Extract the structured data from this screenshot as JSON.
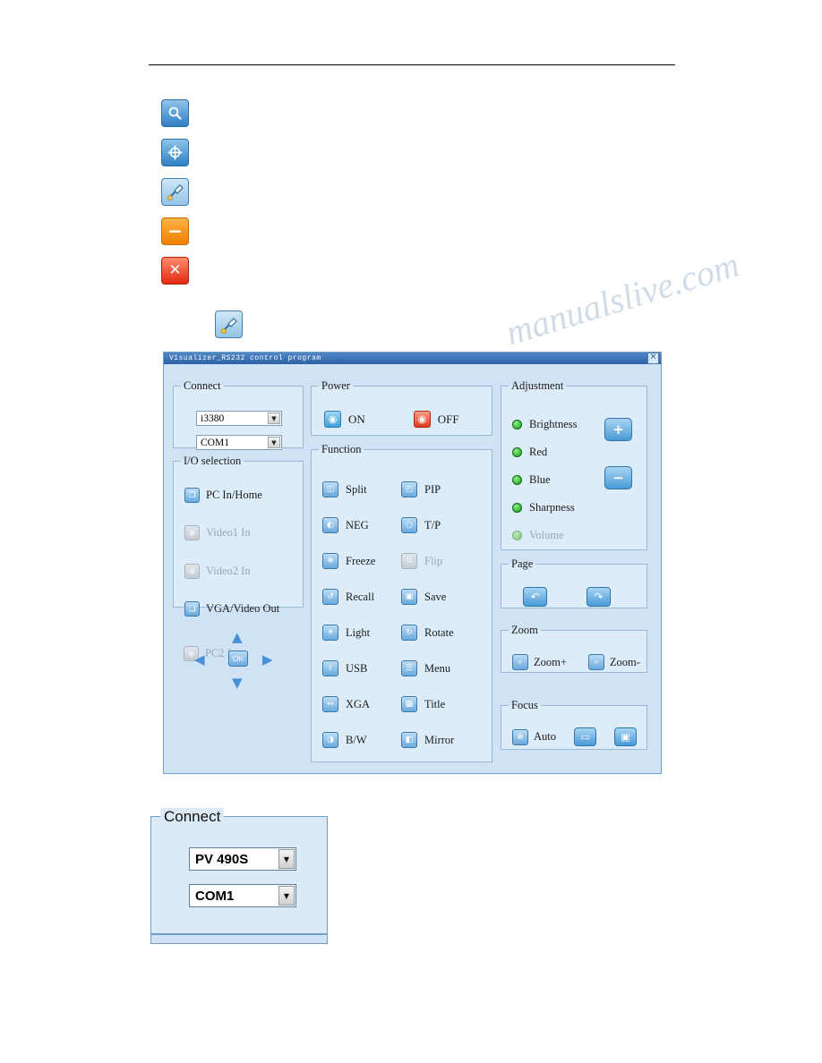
{
  "icon_column": [
    {
      "name": "search-icon",
      "glyph": "⌕"
    },
    {
      "name": "focus-target-icon",
      "glyph": "⊕"
    },
    {
      "name": "lamp-icon",
      "glyph": ""
    },
    {
      "name": "minimize-icon",
      "glyph": "−"
    },
    {
      "name": "close-icon",
      "glyph": "✕"
    }
  ],
  "window": {
    "title": "Visualizer_RS232 control program",
    "close_label": "×"
  },
  "connect": {
    "legend": "Connect",
    "model": "i3380",
    "port": "COM1",
    "arrow": "▼"
  },
  "io_selection": {
    "legend": "I/O selection",
    "items": [
      {
        "label": "PC In/Home",
        "glyph": "❐",
        "enabled": true
      },
      {
        "label": "Video1 In",
        "glyph": "◉",
        "enabled": false
      },
      {
        "label": "Video2 In",
        "glyph": "◉",
        "enabled": false
      },
      {
        "label": "VGA/Video Out",
        "glyph": "❑",
        "enabled": true
      },
      {
        "label": "PC2 In",
        "glyph": "◉",
        "enabled": false
      }
    ]
  },
  "navpad": {
    "up": "▲",
    "down": "▼",
    "left": "◀",
    "right": "▶",
    "ok": "OK"
  },
  "power": {
    "legend": "Power",
    "on_label": "ON",
    "off_label": "OFF",
    "on_glyph": "◉",
    "off_glyph": "◉"
  },
  "function": {
    "legend": "Function",
    "items": [
      {
        "label": "Split",
        "glyph": "◫",
        "enabled": true
      },
      {
        "label": "PIP",
        "glyph": "◰",
        "enabled": true
      },
      {
        "label": "NEG",
        "glyph": "◐",
        "enabled": true
      },
      {
        "label": "T/P",
        "glyph": "○",
        "enabled": true
      },
      {
        "label": "Freeze",
        "glyph": "❄",
        "enabled": true
      },
      {
        "label": "Flip",
        "glyph": "⇅",
        "enabled": false
      },
      {
        "label": "Recall",
        "glyph": "↺",
        "enabled": true
      },
      {
        "label": "Save",
        "glyph": "▣",
        "enabled": true
      },
      {
        "label": "Light",
        "glyph": "☀",
        "enabled": true
      },
      {
        "label": "Rotate",
        "glyph": "↻",
        "enabled": true
      },
      {
        "label": "USB",
        "glyph": "⇧",
        "enabled": true
      },
      {
        "label": "Menu",
        "glyph": "☰",
        "enabled": true
      },
      {
        "label": "XGA",
        "glyph": "↔",
        "enabled": true
      },
      {
        "label": "Title",
        "glyph": "▦",
        "enabled": true
      },
      {
        "label": "B/W",
        "glyph": "◑",
        "enabled": true
      },
      {
        "label": "Mirror",
        "glyph": "◧",
        "enabled": true
      }
    ]
  },
  "adjustment": {
    "legend": "Adjustment",
    "items": [
      {
        "label": "Brightness",
        "enabled": true
      },
      {
        "label": "Red",
        "enabled": true
      },
      {
        "label": "Blue",
        "enabled": true
      },
      {
        "label": "Sharpness",
        "enabled": true
      },
      {
        "label": "Volume",
        "enabled": false
      }
    ],
    "plus": "+",
    "minus": "−"
  },
  "page": {
    "legend": "Page",
    "prev_glyph": "↶",
    "next_glyph": "↷"
  },
  "zoom": {
    "legend": "Zoom",
    "items": [
      {
        "label": "Zoom+",
        "glyph": "⌕"
      },
      {
        "label": "Zoom-",
        "glyph": "⌕"
      }
    ]
  },
  "focus": {
    "legend": "Focus",
    "auto_label": "Auto",
    "auto_glyph": "⊕",
    "near_glyph": "▭",
    "far_glyph": "▣"
  },
  "detail_connect": {
    "legend": "Connect",
    "model": "PV 490S",
    "port": "COM1",
    "arrow": "▼"
  },
  "watermark": {
    "line1": "manualslive.com",
    "line2": "manualslive.com"
  }
}
